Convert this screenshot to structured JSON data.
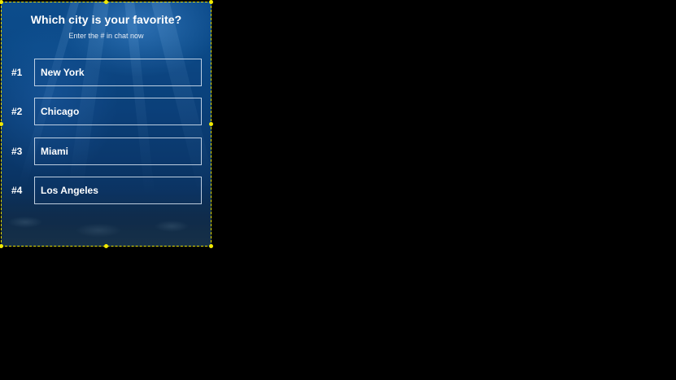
{
  "poll": {
    "title": "Which city is your favorite?",
    "subtitle": "Enter the # in chat now",
    "options": [
      {
        "number": "#1",
        "label": "New York"
      },
      {
        "number": "#2",
        "label": "Chicago"
      },
      {
        "number": "#3",
        "label": "Miami"
      },
      {
        "number": "#4",
        "label": "Los Angeles"
      }
    ]
  },
  "colors": {
    "background": "#000000",
    "selection_handle": "#f2ea00",
    "text": "#ffffff"
  }
}
